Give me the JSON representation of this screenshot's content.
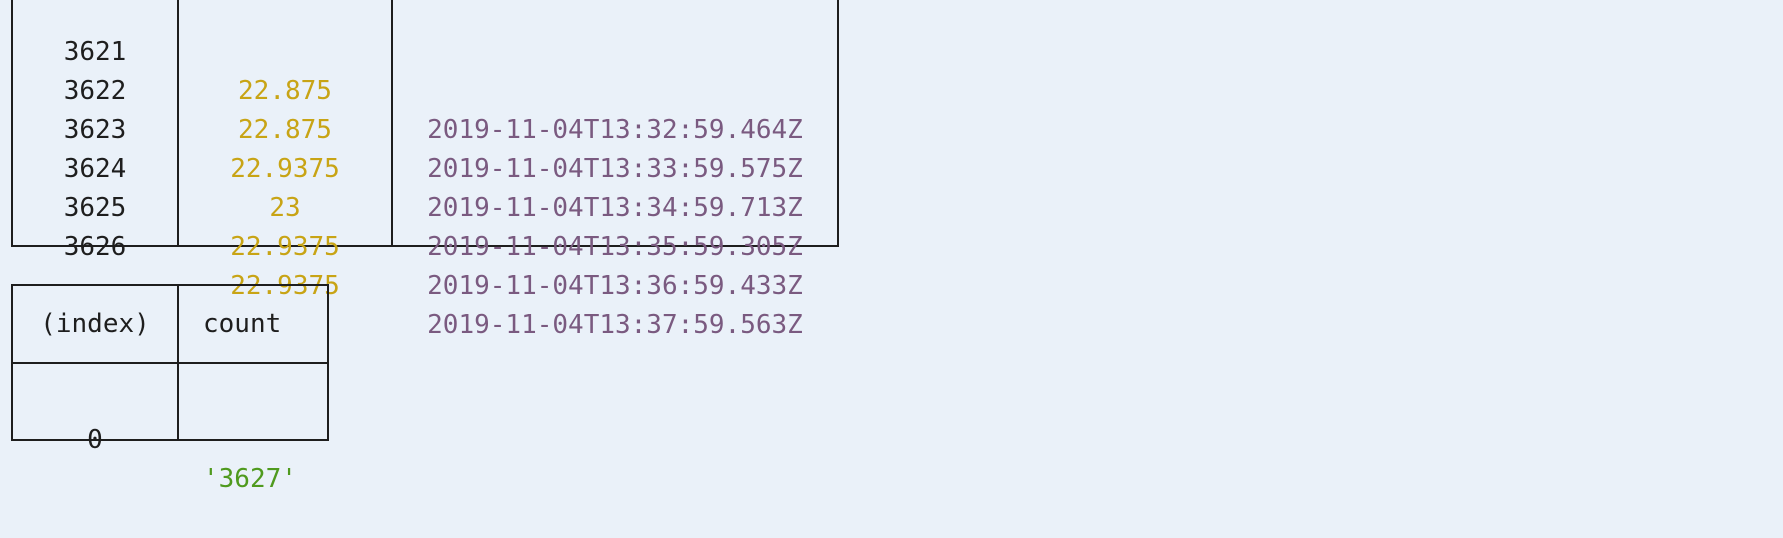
{
  "output_table_1": {
    "rows": [
      {
        "index": "3621",
        "value": "22.875",
        "timestamp": "2019-11-04T13:32:59.464Z"
      },
      {
        "index": "3622",
        "value": "22.875",
        "timestamp": "2019-11-04T13:33:59.575Z"
      },
      {
        "index": "3623",
        "value": "22.9375",
        "timestamp": "2019-11-04T13:34:59.713Z"
      },
      {
        "index": "3624",
        "value": "23",
        "timestamp": "2019-11-04T13:35:59.305Z"
      },
      {
        "index": "3625",
        "value": "22.9375",
        "timestamp": "2019-11-04T13:36:59.433Z"
      },
      {
        "index": "3626",
        "value": "22.9375",
        "timestamp": "2019-11-04T13:37:59.563Z"
      }
    ]
  },
  "output_table_2": {
    "headers": {
      "index": "(index)",
      "count": "count"
    },
    "rows": [
      {
        "index": "0",
        "count": "'3627'"
      }
    ]
  },
  "colors": {
    "background": "#eaf1f9",
    "number": "#c8a415",
    "date": "#7a5a80",
    "string": "#4f9a1e",
    "border": "#1e1e1e"
  }
}
